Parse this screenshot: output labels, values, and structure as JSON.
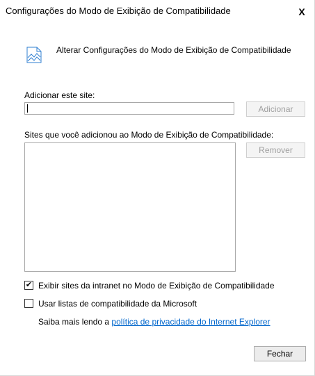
{
  "window": {
    "title": "Configurações do Modo de Exibição de Compatibilidade",
    "close_label": "X"
  },
  "header": {
    "icon": "compatibility-view-icon",
    "text": "Alterar Configurações do Modo de Exibição de Compatibilidade"
  },
  "add_site": {
    "label": "Adicionar este site:",
    "value": "",
    "button_label": "Adicionar"
  },
  "sites_list": {
    "label": "Sites que você adicionou ao Modo de Exibição de Compatibilidade:",
    "items": [],
    "remove_label": "Remover"
  },
  "options": {
    "intranet": {
      "label": "Exibir sites da intranet no Modo de Exibição de Compatibilidade",
      "checked": true,
      "mark": "✔"
    },
    "microsoft_lists": {
      "label": "Usar listas de compatibilidade da Microsoft",
      "checked": false,
      "mark": ""
    }
  },
  "privacy": {
    "prefix": "Saiba mais lendo a ",
    "link_text": "política de privacidade do Internet Explorer"
  },
  "footer": {
    "close_button_label": "Fechar"
  }
}
